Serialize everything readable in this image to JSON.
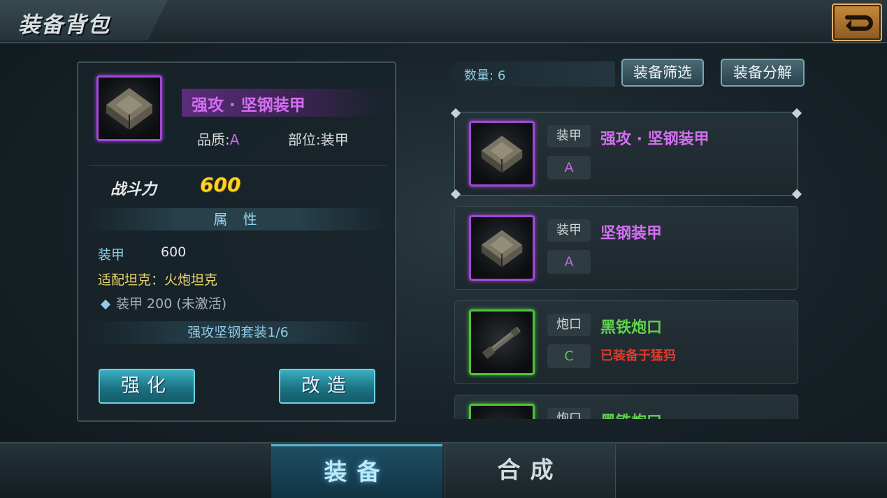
{
  "header": {
    "title": "装备背包"
  },
  "detail": {
    "name": "强攻 · 坚钢装甲",
    "quality_label": "品质:",
    "quality_value": "A",
    "slot_label": "部位:",
    "slot_value": "装甲",
    "power_label": "战斗力",
    "power_value": "600",
    "attr_header": "属 性",
    "attr_name": "装甲",
    "attr_value": "600",
    "fit_tank": "适配坦克：火炮坦克",
    "bonus": "装甲 200 (未激活)",
    "suit": "强攻坚钢套装1/6",
    "enhance_label": "强化",
    "modify_label": "改造"
  },
  "list": {
    "count_label": "数量:",
    "count_value": "6",
    "filter_label": "装备筛选",
    "decompose_label": "装备分解",
    "items": [
      {
        "slot": "装甲",
        "grade": "A",
        "name": "强攻 · 坚钢装甲",
        "note": ""
      },
      {
        "slot": "装甲",
        "grade": "A",
        "name": "坚钢装甲",
        "note": ""
      },
      {
        "slot": "炮口",
        "grade": "C",
        "name": "黑铁炮口",
        "note": "已装备于猛犸"
      },
      {
        "slot": "炮口",
        "grade": "",
        "name": "黑铁炮口",
        "note": ""
      }
    ]
  },
  "tabs": [
    {
      "label": "装备"
    },
    {
      "label": "合成"
    }
  ],
  "colors": {
    "purple_grade": "#a346d8",
    "green_grade": "#4dc23a",
    "power_gold": "#ffd21e",
    "warning_red": "#e03a2c"
  }
}
